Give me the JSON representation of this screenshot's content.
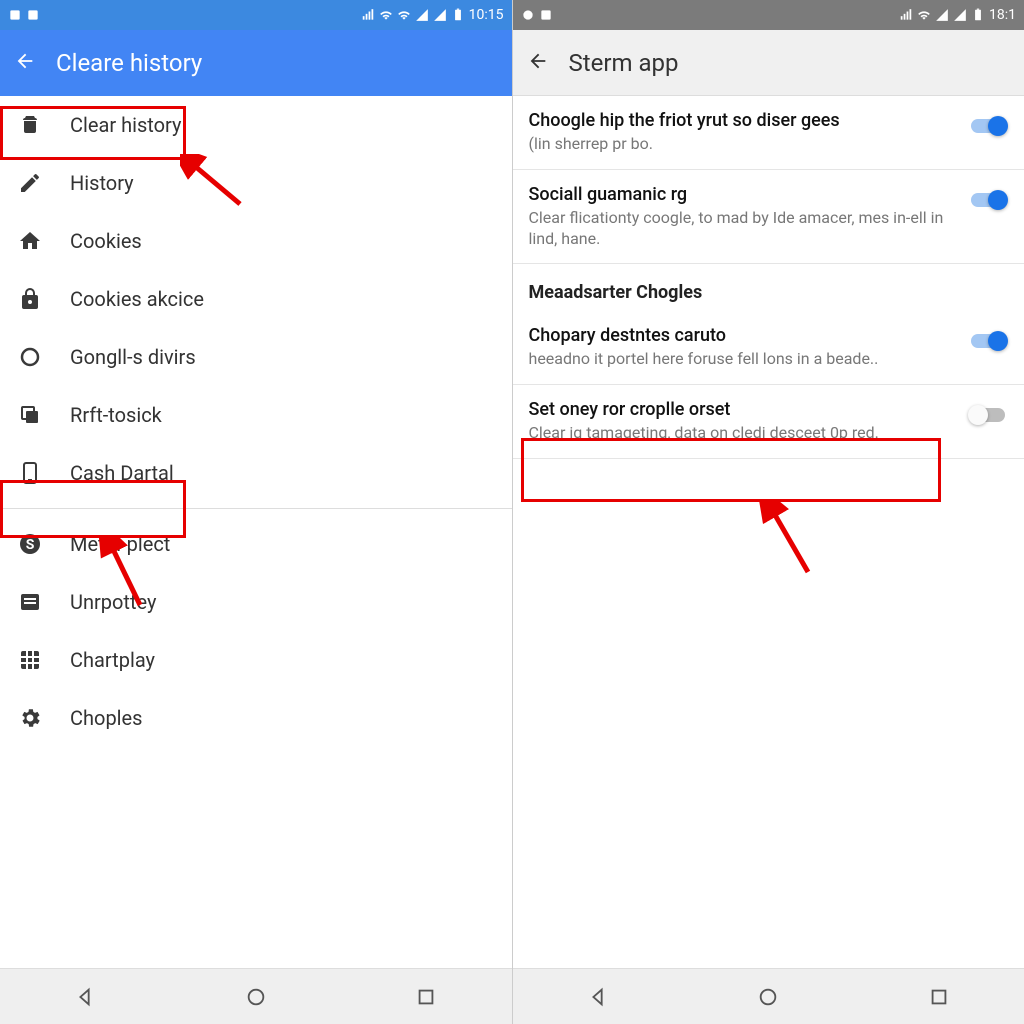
{
  "left": {
    "statusbar": {
      "time": "10:15"
    },
    "header": {
      "title": "Cleare history"
    },
    "menu": [
      {
        "icon": "android",
        "label": "Clear history"
      },
      {
        "icon": "pencil",
        "label": "History"
      },
      {
        "icon": "home",
        "label": "Cookies"
      },
      {
        "icon": "lock",
        "label": "Cookies akcice"
      },
      {
        "icon": "circle",
        "label": "Gongll-s divirs"
      },
      {
        "icon": "copy",
        "label": "Rrft-tosick"
      },
      {
        "icon": "phone",
        "label": "Cash Dartal"
      }
    ],
    "menu2": [
      {
        "icon": "dollar",
        "label": "Metirl-plect"
      },
      {
        "icon": "list",
        "label": "Unrpottey"
      },
      {
        "icon": "grid",
        "label": "Chartplay"
      },
      {
        "icon": "gear",
        "label": "Choples"
      }
    ]
  },
  "right": {
    "statusbar": {
      "time": "18:1"
    },
    "header": {
      "title": "Sterm app"
    },
    "rows": [
      {
        "title": "Choogle hip the friot yrut so diser gees",
        "sub": "(lin sherrep pr bo.",
        "on": true
      },
      {
        "title": "Sociall guamanic rg",
        "sub": "Clear flicationty coogle, to mad by Ide amacer, mes in-ell in lind, hane.",
        "on": true
      }
    ],
    "section": "Meaadsarter Chogles",
    "rows2": [
      {
        "title": "Chopary destntes caruto",
        "sub": "heeadno it portel here foruse fell lons in a beade..",
        "on": true
      },
      {
        "title": "Set oney ror croplle orset",
        "sub": "Clear ig tamageting, data on cledi desceet 0p red.",
        "on": false
      }
    ]
  }
}
